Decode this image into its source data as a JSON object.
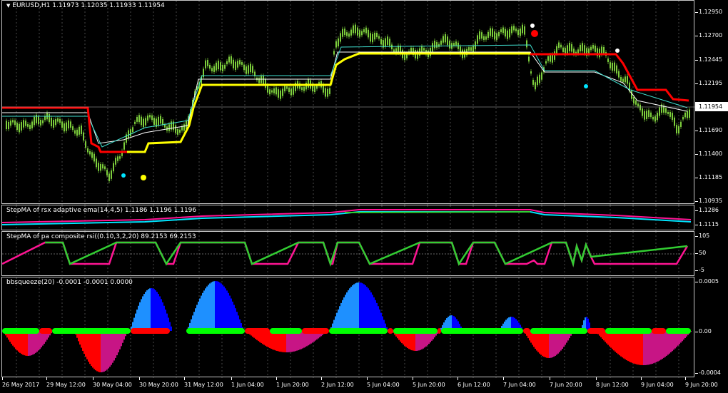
{
  "main": {
    "symbol_header": "EURUSD,H1  1.11973 1.12035 1.11933 1.11954",
    "menu_icon": "triangle-down-icon",
    "price_levels": [
      "1.12950",
      "1.12700",
      "1.12445",
      "1.12195",
      "1.11954",
      "1.11690",
      "1.11400",
      "1.11185",
      "1.10935"
    ],
    "current_price": "1.11954"
  },
  "indicator1": {
    "title": "StepMA of rsx adaptive ema(14,4,5) 1.1186 1.1196 1.1196",
    "levels": [
      "1.1286",
      "1.1115"
    ]
  },
  "indicator2": {
    "title": "StepMA of pa composite rsi((0.10,3,2,20) 89.2153 69.2153",
    "levels": [
      "105",
      "50",
      "-5"
    ]
  },
  "indicator3": {
    "title": "bbsqueeze(20) -0.0001 -0.0001 0.0000",
    "levels": [
      "0.0005",
      "0.00",
      "-0.0004"
    ]
  },
  "time_axis": [
    "26 May 2017",
    "29 May 12:00",
    "30 May 04:00",
    "30 May 20:00",
    "31 May 12:00",
    "1 Jun 04:00",
    "1 Jun 20:00",
    "2 Jun 12:00",
    "5 Jun 04:00",
    "5 Jun 20:00",
    "6 Jun 12:00",
    "7 Jun 04:00",
    "7 Jun 20:00",
    "8 Jun 12:00",
    "9 Jun 04:00",
    "9 Jun 20:00"
  ],
  "colors": {
    "bull_candle": "#7ccd3c",
    "bear_candle": "#7ccd3c",
    "step_red": "#ff0000",
    "step_yellow": "#ffff00",
    "line_cyan": "#40e0d0",
    "line_white": "#ffffff",
    "rsx_magenta": "#ff1493",
    "rsi_green": "#32cd32",
    "hist_blue": "#1e90ff",
    "hist_darkblue": "#0000ff",
    "hist_red": "#ff0000",
    "hist_purple": "#c71585",
    "squeeze_green": "#00ff00"
  }
}
